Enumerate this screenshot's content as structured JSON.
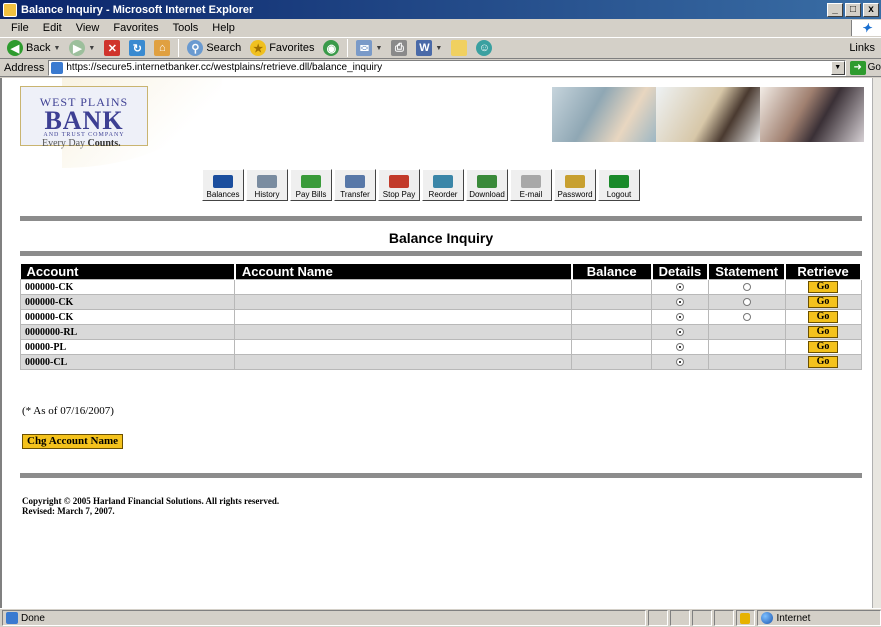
{
  "window": {
    "title": "Balance Inquiry - Microsoft Internet Explorer",
    "min_glyph": "_",
    "max_glyph": "□",
    "close_glyph": "x"
  },
  "menu": [
    "File",
    "Edit",
    "View",
    "Favorites",
    "Tools",
    "Help"
  ],
  "toolbar": {
    "back": "Back",
    "search": "Search",
    "favorites": "Favorites",
    "links": "Links"
  },
  "address": {
    "label": "Address",
    "url": "https://secure5.internetbanker.cc/westplains/retrieve.dll/balance_inquiry",
    "go": "Go"
  },
  "brand": {
    "line1": "WEST PLAINS",
    "line2": "BANK",
    "line3": "AND TRUST COMPANY",
    "tagline_prefix": "Every Day ",
    "tagline_bold": "Counts."
  },
  "nav": [
    {
      "label": "Balances",
      "color": "#1b4e9e"
    },
    {
      "label": "History",
      "color": "#7a8ca0"
    },
    {
      "label": "Pay Bills",
      "color": "#3a9b3a"
    },
    {
      "label": "Transfer",
      "color": "#5878a8"
    },
    {
      "label": "Stop Pay",
      "color": "#c23a2a"
    },
    {
      "label": "Reorder",
      "color": "#3b86a8"
    },
    {
      "label": "Download",
      "color": "#3a8a3a"
    },
    {
      "label": "E-mail",
      "color": "#a8a8a8"
    },
    {
      "label": "Password",
      "color": "#c8a030"
    },
    {
      "label": "Logout",
      "color": "#1a8a2a"
    }
  ],
  "page_title": "Balance Inquiry",
  "table": {
    "headers": {
      "account": "Account",
      "name": "Account Name",
      "balance": "Balance",
      "details": "Details",
      "statement": "Statement",
      "retrieve": "Retrieve"
    },
    "rows": [
      {
        "account": "000000-CK",
        "name": "",
        "balance": "",
        "details": true,
        "statement": true,
        "go": "Go"
      },
      {
        "account": "000000-CK",
        "name": "",
        "balance": "",
        "details": true,
        "statement": true,
        "go": "Go"
      },
      {
        "account": "000000-CK",
        "name": "",
        "balance": "",
        "details": true,
        "statement": true,
        "go": "Go"
      },
      {
        "account": "0000000-RL",
        "name": "",
        "balance": "",
        "details": true,
        "statement": false,
        "go": "Go"
      },
      {
        "account": "00000-PL",
        "name": "",
        "balance": "",
        "details": true,
        "statement": false,
        "go": "Go"
      },
      {
        "account": "00000-CL",
        "name": "",
        "balance": "",
        "details": true,
        "statement": false,
        "go": "Go"
      }
    ]
  },
  "as_of": "(* As of 07/16/2007)",
  "chg_button": "Chg Account Name",
  "footer": {
    "line1": "Copyright © 2005 Harland Financial Solutions.  All rights reserved.",
    "line2": "Revised: March 7, 2007."
  },
  "status": {
    "text": "Done",
    "zone": "Internet"
  }
}
